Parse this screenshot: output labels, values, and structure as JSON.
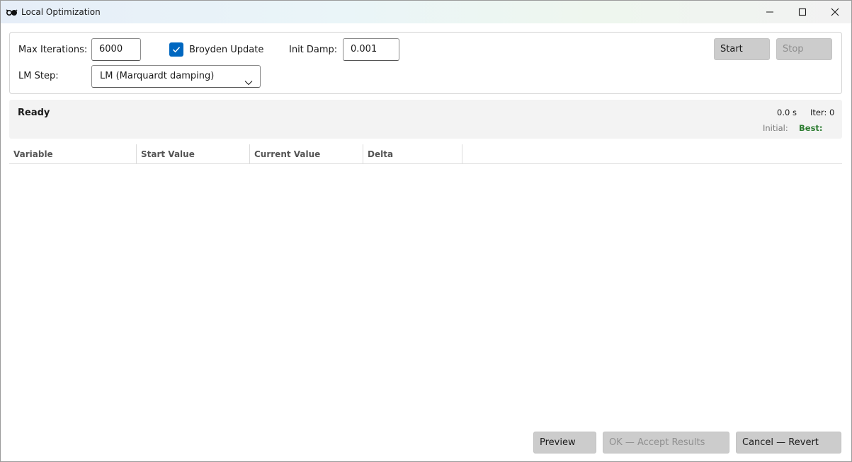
{
  "window": {
    "title": "Local Optimization",
    "icon": "glasses-icon"
  },
  "settings": {
    "max_iterations_label": "Max Iterations:",
    "max_iterations_value": "6000",
    "broyden_label": "Broyden Update",
    "broyden_checked": true,
    "init_damp_label": "Init Damp:",
    "init_damp_value": "0.001",
    "lm_step_label": "LM Step:",
    "lm_step_value": "LM (Marquardt damping)",
    "start_label": "Start",
    "stop_label": "Stop"
  },
  "status": {
    "state": "Ready",
    "time": "0.0 s",
    "iter": "Iter: 0",
    "initial_label": "Initial:",
    "best_label": "Best:"
  },
  "table": {
    "columns": [
      "Variable",
      "Start Value",
      "Current Value",
      "Delta"
    ],
    "rows": []
  },
  "footer": {
    "preview_label": "Preview",
    "ok_label": "OK — Accept Results",
    "cancel_label": "Cancel — Revert"
  },
  "colors": {
    "accent": "#0067c0",
    "best": "#2e7d32"
  }
}
